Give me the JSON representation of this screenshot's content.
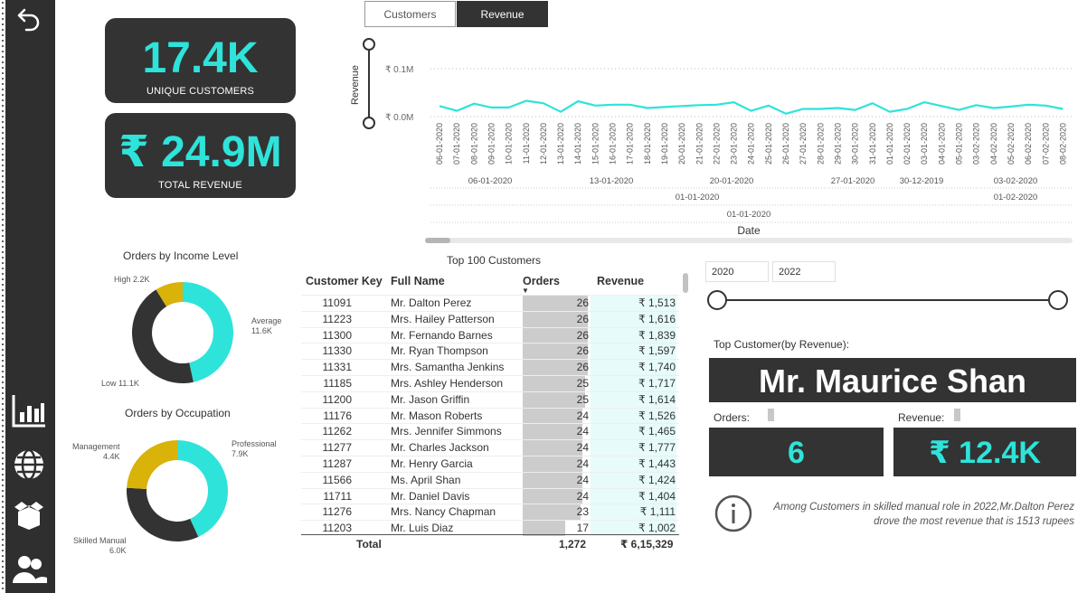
{
  "kpis": {
    "customers_value": "17.4K",
    "customers_label": "UNIQUE CUSTOMERS",
    "revenue_value": "₹ 24.9M",
    "revenue_label": "TOTAL REVENUE"
  },
  "tabs": {
    "customers": "Customers",
    "revenue": "Revenue",
    "active": "Revenue"
  },
  "sidebar_icons": [
    "back-arrow-icon",
    "bar-chart-icon",
    "globe-icon",
    "product-box-icon",
    "customers-icon"
  ],
  "line_chart": {
    "y_axis_title": "Revenue",
    "x_axis_title": "Date",
    "y_ticks": [
      "₹ 0.1M",
      "₹ 0.0M"
    ],
    "x_dates": [
      "06-01-2020",
      "07-01-2020",
      "08-01-2020",
      "09-01-2020",
      "10-01-2020",
      "11-01-2020",
      "12-01-2020",
      "13-01-2020",
      "14-01-2020",
      "15-01-2020",
      "16-01-2020",
      "17-01-2020",
      "18-01-2020",
      "19-01-2020",
      "20-01-2020",
      "21-01-2020",
      "22-01-2020",
      "23-01-2020",
      "24-01-2020",
      "25-01-2020",
      "26-01-2020",
      "27-01-2020",
      "28-01-2020",
      "29-01-2020",
      "30-01-2020",
      "31-01-2020",
      "01-01-2020",
      "02-01-2020",
      "03-01-2020",
      "04-01-2020",
      "05-01-2020",
      "03-02-2020",
      "04-02-2020",
      "05-02-2020",
      "06-02-2020",
      "07-02-2020",
      "08-02-2020"
    ],
    "revenue_values": [
      0.022,
      0.012,
      0.027,
      0.019,
      0.019,
      0.033,
      0.028,
      0.01,
      0.032,
      0.023,
      0.025,
      0.025,
      0.018,
      0.02,
      0.022,
      0.024,
      0.025,
      0.03,
      0.012,
      0.023,
      0.006,
      0.016,
      0.016,
      0.018,
      0.014,
      0.028,
      0.01,
      0.016,
      0.03,
      0.022,
      0.014,
      0.024,
      0.018,
      0.021,
      0.025,
      0.023,
      0.016
    ],
    "week_labels": [
      "06-01-2020",
      "13-01-2020",
      "20-01-2020",
      "27-01-2020",
      "30-12-2019",
      "03-02-2020"
    ],
    "month_labels": [
      "01-01-2020",
      "01-02-2020"
    ],
    "year_labels": [
      "01-01-2020"
    ],
    "line_color": "#2ee3da"
  },
  "income_donut": {
    "title": "Orders by Income Level",
    "slices": [
      {
        "name": "High",
        "value_label": "2.2K",
        "value": 2.2,
        "color": "#d9b20a"
      },
      {
        "name": "Average",
        "value_label": "11.6K",
        "value": 11.6,
        "color": "#2ee3da"
      },
      {
        "name": "Low",
        "value_label": "11.1K",
        "value": 11.1,
        "color": "#333333"
      }
    ]
  },
  "occupation_donut": {
    "title": "Orders by Occupation",
    "slices": [
      {
        "name": "Professional",
        "value_label": "7.9K",
        "value": 7.9,
        "color": "#2ee3da"
      },
      {
        "name": "Skilled Manual",
        "value_label": "6.0K",
        "value": 6.0,
        "color": "#333333"
      },
      {
        "name": "Management",
        "value_label": "4.4K",
        "value": 4.4,
        "color": "#d9b20a"
      }
    ]
  },
  "table": {
    "title": "Top 100 Customers",
    "headers": [
      "Customer Key",
      "Full Name",
      "Orders",
      "Revenue"
    ],
    "rows": [
      {
        "key": "11091",
        "name": "Mr. Dalton Perez",
        "orders": 26,
        "revenue": "₹ 1,513"
      },
      {
        "key": "11223",
        "name": "Mrs. Hailey Patterson",
        "orders": 26,
        "revenue": "₹ 1,616"
      },
      {
        "key": "11300",
        "name": "Mr. Fernando Barnes",
        "orders": 26,
        "revenue": "₹ 1,839"
      },
      {
        "key": "11330",
        "name": "Mr. Ryan Thompson",
        "orders": 26,
        "revenue": "₹ 1,597"
      },
      {
        "key": "11331",
        "name": "Mrs. Samantha Jenkins",
        "orders": 26,
        "revenue": "₹ 1,740"
      },
      {
        "key": "11185",
        "name": "Mrs. Ashley Henderson",
        "orders": 25,
        "revenue": "₹ 1,717"
      },
      {
        "key": "11200",
        "name": "Mr. Jason Griffin",
        "orders": 25,
        "revenue": "₹ 1,614"
      },
      {
        "key": "11176",
        "name": "Mr. Mason Roberts",
        "orders": 24,
        "revenue": "₹ 1,526"
      },
      {
        "key": "11262",
        "name": "Mrs. Jennifer Simmons",
        "orders": 24,
        "revenue": "₹ 1,465"
      },
      {
        "key": "11277",
        "name": "Mr. Charles Jackson",
        "orders": 24,
        "revenue": "₹ 1,777"
      },
      {
        "key": "11287",
        "name": "Mr. Henry Garcia",
        "orders": 24,
        "revenue": "₹ 1,443"
      },
      {
        "key": "11566",
        "name": "Ms. April Shan",
        "orders": 24,
        "revenue": "₹ 1,424"
      },
      {
        "key": "11711",
        "name": "Mr. Daniel Davis",
        "orders": 24,
        "revenue": "₹ 1,404"
      },
      {
        "key": "11276",
        "name": "Mrs. Nancy Chapman",
        "orders": 23,
        "revenue": "₹ 1,111"
      },
      {
        "key": "11203",
        "name": "Mr. Luis Diaz",
        "orders": 17,
        "revenue": "₹ 1,002"
      }
    ],
    "total_label": "Total",
    "total_orders": "1,272",
    "total_revenue": "₹ 6,15,329"
  },
  "slicer": {
    "start_year": "2020",
    "end_year": "2022"
  },
  "top_customer": {
    "label": "Top Customer(by Revenue):",
    "name": "Mr. Maurice Shan",
    "orders_label": "Orders:",
    "orders_value": "6",
    "revenue_label": "Revenue:",
    "revenue_value": "₹ 12.4K"
  },
  "insight": {
    "icon": "info-icon",
    "text": "Among Customers in skilled manual role in 2022,Mr.Dalton Perez drove the most revenue that is 1513 rupees"
  }
}
